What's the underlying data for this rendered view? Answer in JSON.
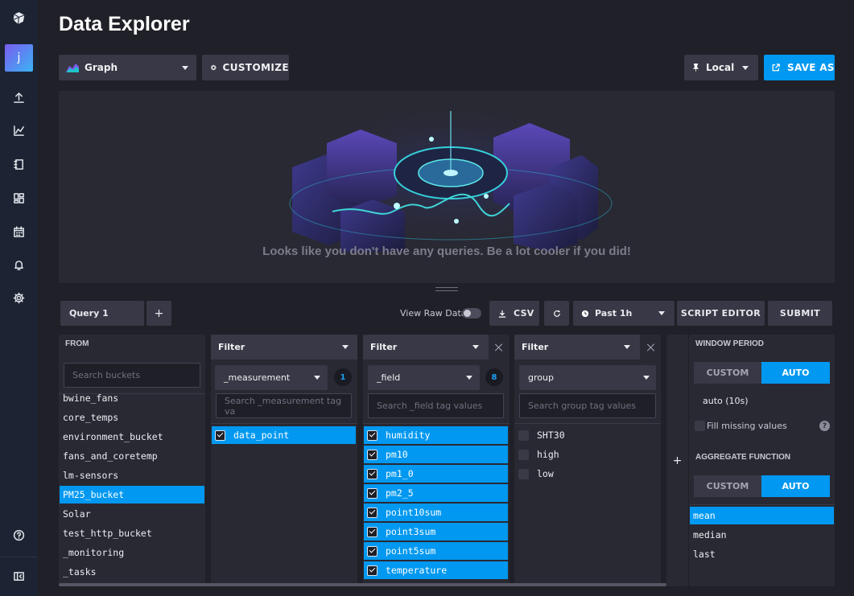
{
  "page": {
    "title": "Data Explorer"
  },
  "sidebar": {
    "avatar_letter": "j"
  },
  "toolbar": {
    "view_type": "Graph",
    "customize_label": "CUSTOMIZE",
    "timezone": "Local",
    "save_as_label": "SAVE AS"
  },
  "graph": {
    "empty_message": "Looks like you don't have any queries. Be a lot cooler if you did!"
  },
  "query_bar": {
    "query_tab": "Query 1",
    "add_tab": "+",
    "view_raw_label": "View Raw Data",
    "view_raw_on": false,
    "csv_label": "CSV",
    "time_range": "Past 1h",
    "script_editor_label": "SCRIPT EDITOR",
    "submit_label": "SUBMIT"
  },
  "from_panel": {
    "header": "FROM",
    "search_placeholder": "Search buckets",
    "buckets": [
      "bwine_fans",
      "core_temps",
      "environment_bucket",
      "fans_and_coretemp",
      "lm-sensors",
      "PM25_bucket",
      "Solar",
      "test_http_bucket",
      "_monitoring",
      "_tasks"
    ],
    "selected": "PM25_bucket"
  },
  "filter_measurement": {
    "header": "Filter",
    "key": "_measurement",
    "count": "1",
    "search_placeholder": "Search _measurement tag va",
    "values": [
      {
        "label": "data_point",
        "checked": true
      }
    ]
  },
  "filter_field": {
    "header": "Filter",
    "key": "_field",
    "count": "8",
    "search_placeholder": "Search _field tag values",
    "values": [
      {
        "label": "humidity",
        "checked": true
      },
      {
        "label": "pm10",
        "checked": true
      },
      {
        "label": "pm1_0",
        "checked": true
      },
      {
        "label": "pm2_5",
        "checked": true
      },
      {
        "label": "point10sum",
        "checked": true
      },
      {
        "label": "point3sum",
        "checked": true
      },
      {
        "label": "point5sum",
        "checked": true
      },
      {
        "label": "temperature",
        "checked": true
      }
    ]
  },
  "filter_group": {
    "header": "Filter",
    "key": "group",
    "search_placeholder": "Search group tag values",
    "values": [
      {
        "label": "SHT30",
        "checked": false
      },
      {
        "label": "high",
        "checked": false
      },
      {
        "label": "low",
        "checked": false
      }
    ]
  },
  "add_filter": "+",
  "aggregate": {
    "window_period_label": "WINDOW PERIOD",
    "custom_label": "CUSTOM",
    "auto_label": "AUTO",
    "auto_value": "auto (10s)",
    "fill_missing_label": "Fill missing values",
    "help_glyph": "?",
    "function_label": "AGGREGATE FUNCTION",
    "functions": [
      "mean",
      "median",
      "last"
    ],
    "selected_function": "mean"
  },
  "colors": {
    "accent": "#0098f0",
    "background": "#202028",
    "panel": "#292933",
    "nav": "#1c2433"
  }
}
